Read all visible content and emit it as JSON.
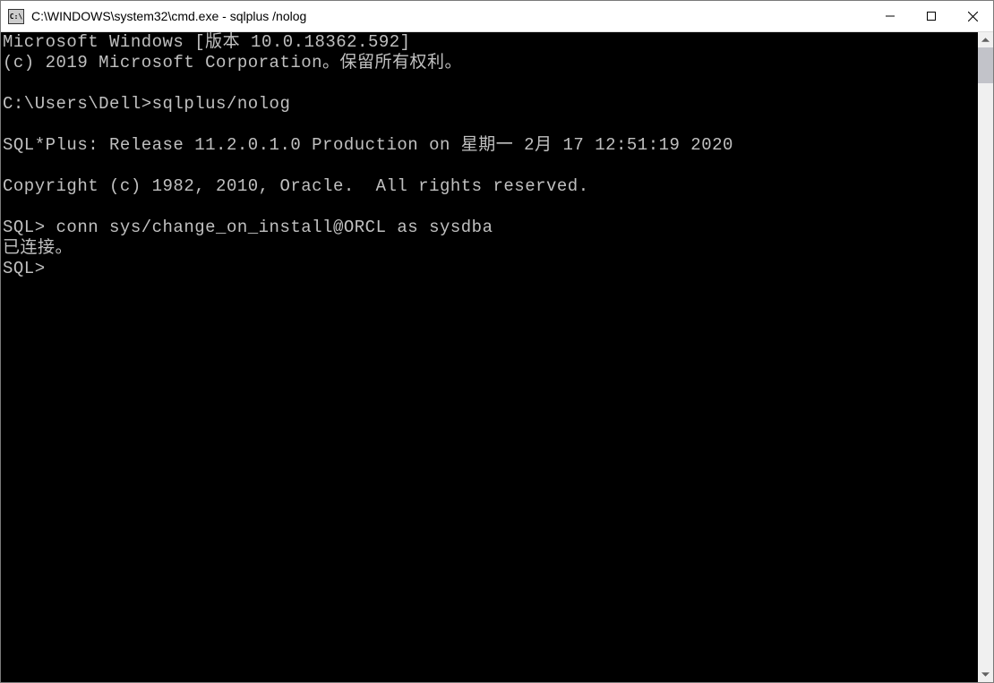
{
  "window": {
    "title": "C:\\WINDOWS\\system32\\cmd.exe - sqlplus /nolog",
    "icon_label": "C:\\"
  },
  "terminal": {
    "lines": [
      "Microsoft Windows [版本 10.0.18362.592]",
      "(c) 2019 Microsoft Corporation。保留所有权利。",
      "",
      "C:\\Users\\Dell>sqlplus/nolog",
      "",
      "SQL*Plus: Release 11.2.0.1.0 Production on 星期一 2月 17 12:51:19 2020",
      "",
      "Copyright (c) 1982, 2010, Oracle.  All rights reserved.",
      "",
      "SQL> conn sys/change_on_install@ORCL as sysdba",
      "已连接。",
      "SQL>"
    ]
  }
}
